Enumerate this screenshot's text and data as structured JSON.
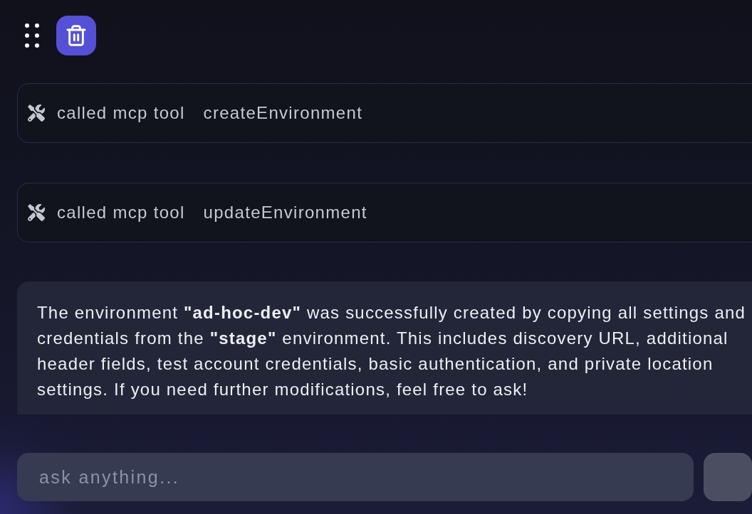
{
  "tool_calls": [
    {
      "label": "called mcp tool",
      "tool": "createEnvironment"
    },
    {
      "label": "called mcp tool",
      "tool": "updateEnvironment"
    }
  ],
  "message": {
    "text": "The environment **\"ad-hoc-dev\"** was successfully created by copying all settings and credentials from the **\"stage\"** environment. This includes discovery URL, additional header fields, test account credentials, basic authentication, and private location settings. If you need further modifications, feel free to ask!"
  },
  "composer": {
    "placeholder": "ask anything..."
  }
}
